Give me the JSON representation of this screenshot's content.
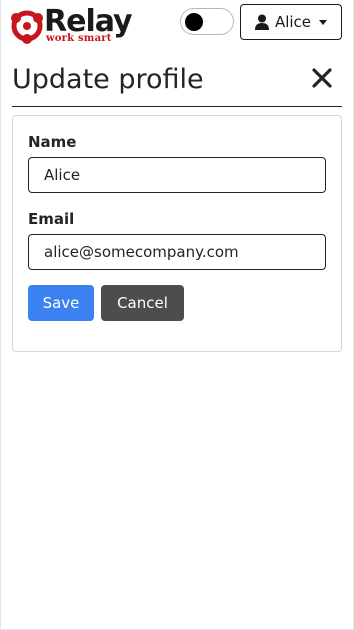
{
  "brand": {
    "name": "Relay",
    "tagline": "work smart",
    "accent_color": "#c4161c"
  },
  "header": {
    "theme_toggle_state": "off",
    "user_menu_label": "Alice",
    "user_icon": "user-icon",
    "dropdown_icon": "caret-down-icon"
  },
  "page": {
    "title": "Update profile",
    "close_icon": "close-icon"
  },
  "form": {
    "name_label": "Name",
    "name_value": "Alice",
    "email_label": "Email",
    "email_value": "alice@somecompany.com",
    "save_label": "Save",
    "cancel_label": "Cancel",
    "save_color": "#3b82f0",
    "cancel_color": "#4d4d4d"
  }
}
